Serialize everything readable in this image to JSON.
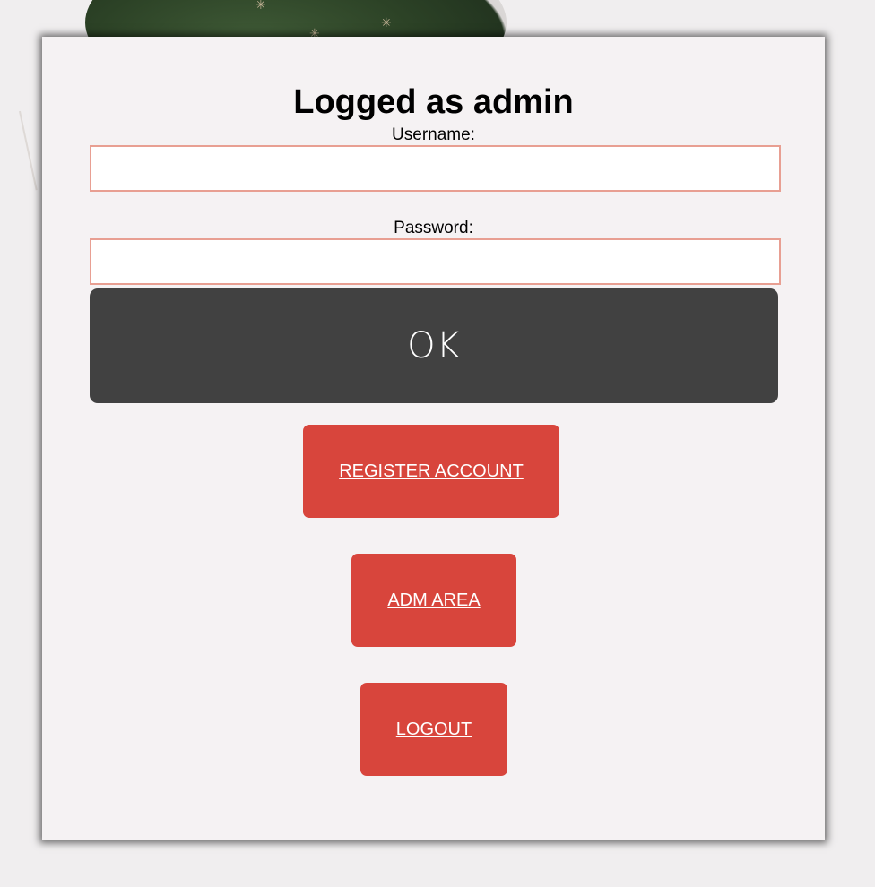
{
  "heading": "Logged as admin",
  "form": {
    "username_label": "Username:",
    "username_value": "",
    "password_label": "Password:",
    "password_value": "",
    "submit_label": "OK"
  },
  "actions": {
    "register_label": "REGISTER ACCOUNT",
    "adm_label": "ADM AREA",
    "logout_label": "LOGOUT"
  },
  "colors": {
    "accent": "#d8453c",
    "submit_bg": "#414141",
    "field_border": "#e89f92",
    "panel_bg": "#f5f2f3"
  }
}
